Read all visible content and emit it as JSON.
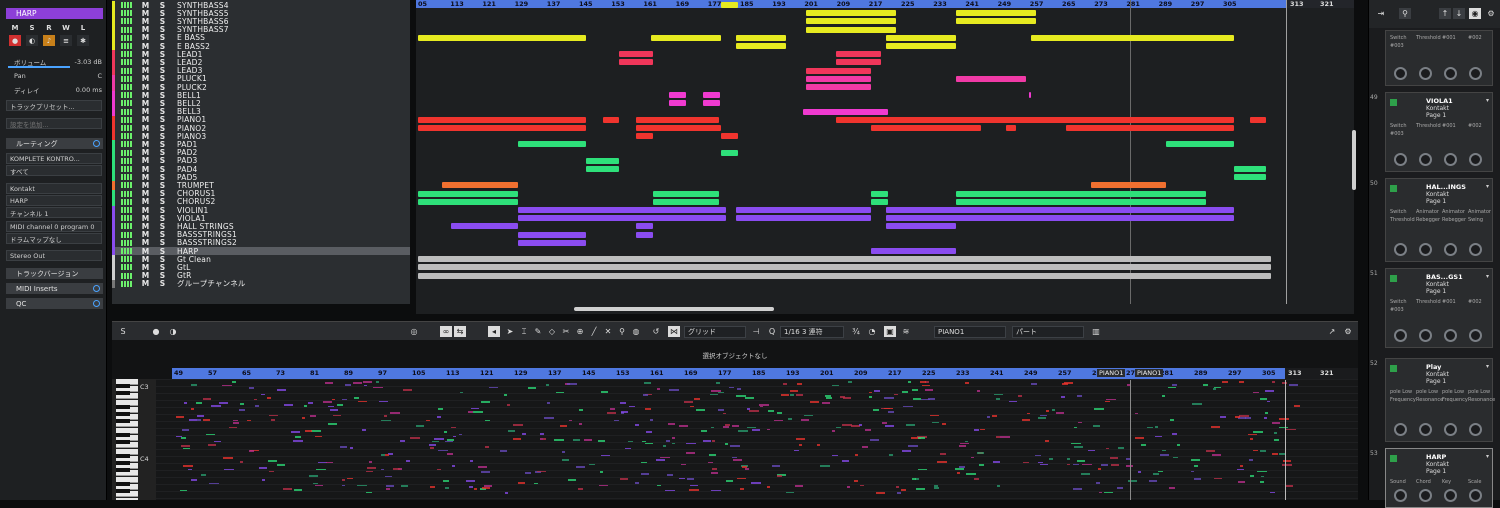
{
  "inspector": {
    "track_name": "HARP",
    "buttons": [
      "M",
      "S",
      "R",
      "W",
      "L"
    ],
    "volume_label": "ボリューム",
    "volume_value": "-3.03 dB",
    "pan_label": "Pan",
    "pan_value": "C",
    "delay_label": "ディレイ",
    "delay_value": "0.00 ms",
    "track_preset_placeholder": "トラックプリセット...",
    "note_placeholder": "設定を追加...",
    "routing_label": "ルーティング",
    "input_routing": "KOMPLETE KONTRO...",
    "input_channel": "すべて",
    "instrument": "Kontakt",
    "output": "HARP",
    "channel": "チャンネル 1",
    "program": "MIDI channel 0 program 0",
    "drum_map": "ドラムマップなし",
    "stereo_out": "Stereo Out",
    "sections": [
      "トラックバージョン",
      "MIDI Inserts",
      "QC"
    ]
  },
  "tracks": [
    {
      "name": "SYNTHBASS4",
      "color": "#e6ea20"
    },
    {
      "name": "SYNTHBASS5",
      "color": "#e6ea20"
    },
    {
      "name": "SYNTHBASS6",
      "color": "#e6ea20"
    },
    {
      "name": "SYNTHBASS7",
      "color": "#e6ea20"
    },
    {
      "name": "E BASS",
      "color": "#e6ea20"
    },
    {
      "name": "E BASS2",
      "color": "#e6ea20"
    },
    {
      "name": "LEAD1",
      "color": "#f0365a"
    },
    {
      "name": "LEAD2",
      "color": "#f0365a"
    },
    {
      "name": "LEAD3",
      "color": "#f0365a"
    },
    {
      "name": "PLUCK1",
      "color": "#f03aa6"
    },
    {
      "name": "PLUCK2",
      "color": "#f03aa6"
    },
    {
      "name": "BELL1",
      "color": "#f03ad0"
    },
    {
      "name": "BELL2",
      "color": "#f03ad0"
    },
    {
      "name": "BELL3",
      "color": "#f03ad0"
    },
    {
      "name": "PIANO1",
      "color": "#f0342e"
    },
    {
      "name": "PIANO2",
      "color": "#f0342e"
    },
    {
      "name": "PIANO3",
      "color": "#f0342e"
    },
    {
      "name": "PAD1",
      "color": "#2ee07a"
    },
    {
      "name": "PAD2",
      "color": "#2ee07a"
    },
    {
      "name": "PAD3",
      "color": "#2ee07a"
    },
    {
      "name": "PAD4",
      "color": "#2ee07a"
    },
    {
      "name": "PAD5",
      "color": "#2ee07a"
    },
    {
      "name": "TRUMPET",
      "color": "#f07030"
    },
    {
      "name": "CHORUS1",
      "color": "#2ee07a"
    },
    {
      "name": "CHORUS2",
      "color": "#2ee07a"
    },
    {
      "name": "VIOLIN1",
      "color": "#8a4cf0"
    },
    {
      "name": "VIOLA1",
      "color": "#8a4cf0"
    },
    {
      "name": "HALL STRINGS",
      "color": "#8a4cf0"
    },
    {
      "name": "BASSSTRINGS1",
      "color": "#8a4cf0"
    },
    {
      "name": "BASSSTRINGS2",
      "color": "#8a4cf0"
    },
    {
      "name": "HARP",
      "color": "#8a4cf0"
    },
    {
      "name": "Gt Clean",
      "color": "#cfcfcf"
    },
    {
      "name": "GtL",
      "color": "#cfcfcf"
    },
    {
      "name": "GtR",
      "color": "#cfcfcf"
    },
    {
      "name": "グループチャンネル",
      "color": "#777"
    }
  ],
  "mute_label": "M",
  "solo_label": "S",
  "ruler_ticks": [
    "05",
    "113",
    "121",
    "129",
    "137",
    "145",
    "153",
    "161",
    "169",
    "177",
    "185",
    "193",
    "201",
    "209",
    "217",
    "225",
    "233",
    "241",
    "249",
    "257",
    "265",
    "273",
    "281",
    "289",
    "297",
    "305",
    "313",
    "321"
  ],
  "editor": {
    "status": "選択オブジェクトなし",
    "grid_label": "グリッド",
    "quantize": "1/16 3 連符",
    "part_name": "PIANO1",
    "part_label": "パート",
    "ruler_ticks": [
      "49",
      "57",
      "65",
      "73",
      "81",
      "89",
      "97",
      "105",
      "113",
      "121",
      "129",
      "137",
      "145",
      "153",
      "161",
      "169",
      "177",
      "185",
      "193",
      "201",
      "209",
      "217",
      "225",
      "233",
      "241",
      "249",
      "257",
      "265",
      "273",
      "281",
      "289",
      "297",
      "305",
      "313",
      "321"
    ],
    "part_markers": [
      "PIANO1",
      "PIANO1"
    ],
    "key_labels": [
      "C3",
      "C4"
    ]
  },
  "rack": {
    "slots": [
      {
        "num": "",
        "name": "",
        "plugin": "",
        "page": "",
        "labels": [
          "Switch",
          "Threshold",
          "#001",
          "#002",
          "#003"
        ]
      },
      {
        "num": "49",
        "name": "VIOLA1",
        "plugin": "Kontakt",
        "page": "Page 1",
        "labels": [
          "Switch",
          "Threshold",
          "#001",
          "#002",
          "#003"
        ]
      },
      {
        "num": "50",
        "name": "HAL...INGS",
        "plugin": "Kontakt",
        "page": "Page 1",
        "labels": [
          "Switch",
          "Animator",
          "Animator",
          "Animator",
          "Threshold",
          "Rebegger",
          "Rebegger",
          "Swing"
        ]
      },
      {
        "num": "51",
        "name": "BAS...GS1",
        "plugin": "Kontakt",
        "page": "Page 1",
        "labels": [
          "Switch",
          "Threshold",
          "#001",
          "#002",
          "#003"
        ]
      },
      {
        "num": "52",
        "name": "Play",
        "plugin": "Kontakt",
        "page": "Page 1",
        "labels": [
          "pole Low",
          "pole Low",
          "pole Low",
          "pole Low",
          "Frequency",
          "Resonance",
          "Frequency",
          "Resonance"
        ]
      },
      {
        "num": "53",
        "name": "HARP",
        "plugin": "Kontakt",
        "page": "Page 1",
        "labels": [
          "Sound",
          "Chord",
          "Key",
          "Scale"
        ]
      }
    ]
  },
  "colors": {
    "ruler": "#4f78e0",
    "accent": "#7a3cc8"
  }
}
